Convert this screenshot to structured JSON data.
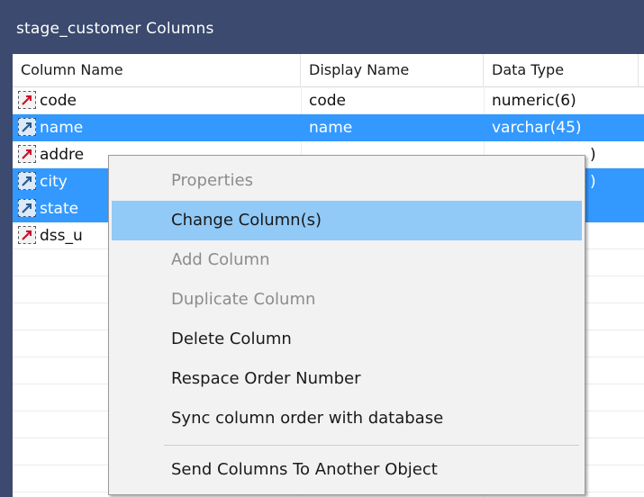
{
  "window": {
    "title": "stage_customer Columns"
  },
  "grid": {
    "columns": [
      "Column Name",
      "Display Name",
      "Data Type"
    ],
    "rows": [
      {
        "name": "code",
        "display": "code",
        "type": "numeric(6)",
        "selected": false
      },
      {
        "name": "name",
        "display": "name",
        "type": "varchar(45)",
        "selected": true
      },
      {
        "name": "addre",
        "display": "",
        "type": ")",
        "selected": false
      },
      {
        "name": "city",
        "display": "",
        "type": ")",
        "selected": true
      },
      {
        "name": "state",
        "display": "",
        "type": "",
        "selected": true
      },
      {
        "name": "dss_u",
        "display": "",
        "type": "",
        "selected": false
      }
    ]
  },
  "context_menu": {
    "items": [
      {
        "label": "Properties",
        "enabled": false
      },
      {
        "label": "Change Column(s)",
        "enabled": true,
        "highlighted": true
      },
      {
        "label": "Add Column",
        "enabled": false
      },
      {
        "label": "Duplicate Column",
        "enabled": false
      },
      {
        "label": "Delete Column",
        "enabled": true
      },
      {
        "label": "Respace Order Number",
        "enabled": true
      },
      {
        "label": "Sync column order with database",
        "enabled": true
      },
      {
        "label": "Send Columns To Another Object",
        "enabled": true
      }
    ]
  },
  "icons": {
    "row_icon": "table-column-icon"
  },
  "colors": {
    "selection": "#3399ff",
    "menu_highlight": "#91c9f7",
    "titlebar": "#3b4a6e"
  }
}
